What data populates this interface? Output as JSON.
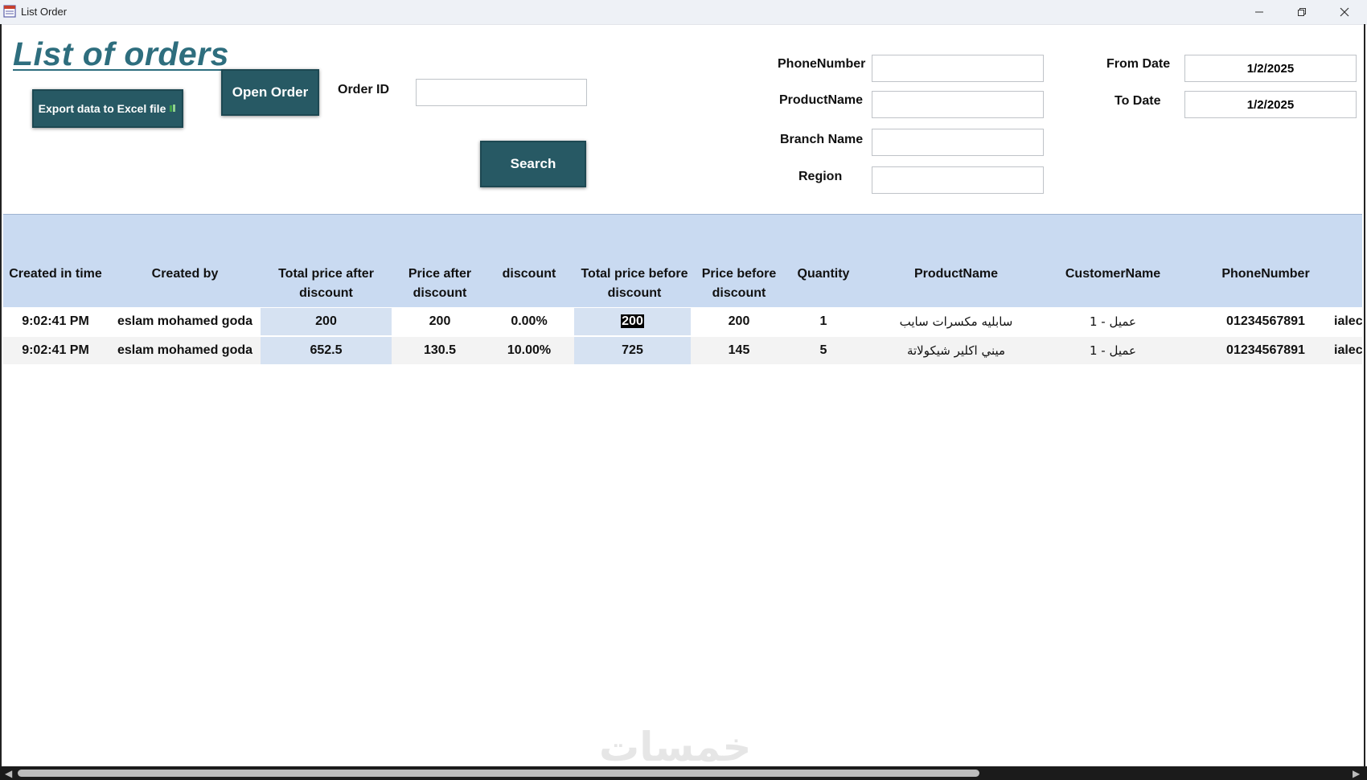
{
  "window": {
    "title": "List Order"
  },
  "form": {
    "title": "List of orders",
    "export_label": "Export data to Excel file",
    "open_order_label": "Open Order",
    "search_label": "Search",
    "order_id": {
      "label": "Order ID",
      "value": ""
    },
    "phone_number": {
      "label": "PhoneNumber",
      "value": ""
    },
    "product_name": {
      "label": "ProductName",
      "value": ""
    },
    "branch_name": {
      "label": "Branch Name",
      "value": ""
    },
    "region": {
      "label": "Region",
      "value": ""
    },
    "from_date": {
      "label": "From Date",
      "value": "1/2/2025"
    },
    "to_date": {
      "label": "To Date",
      "value": "1/2/2025"
    }
  },
  "grid": {
    "columns": [
      "Created in time",
      "Created by",
      "Total price after discount",
      "Price after discount",
      "discount",
      "Total price before discount",
      "Price before discount",
      "Quantity",
      "ProductName",
      "CustomerName",
      "PhoneNumber"
    ],
    "rows": [
      {
        "created_time": "9:02:41 PM",
        "created_by": "eslam mohamed goda",
        "total_after": "200",
        "price_after": "200",
        "discount": "0.00%",
        "total_before": "200",
        "price_before": "200",
        "quantity": "1",
        "product": "سابليه مكسرات سايب",
        "customer": "عميل - 1",
        "phone": "01234567891",
        "overflow": "ialec"
      },
      {
        "created_time": "9:02:41 PM",
        "created_by": "eslam mohamed goda",
        "total_after": "652.5",
        "price_after": "130.5",
        "discount": "10.00%",
        "total_before": "725",
        "price_before": "145",
        "quantity": "5",
        "product": "ميني اكلير شيكولاتة",
        "customer": "عميل - 1",
        "phone": "01234567891",
        "overflow": "ialec"
      }
    ]
  },
  "watermark": "خمسات",
  "icons": {
    "app": "form-icon",
    "minimize": "minimize-icon",
    "restore": "restore-icon",
    "close": "close-icon",
    "excel": "excel-icon"
  },
  "colors": {
    "button_bg": "#275964",
    "title": "#2e6e7e",
    "grid_header": "#c9daf1",
    "highlight_cell": "#d6e2f2"
  }
}
